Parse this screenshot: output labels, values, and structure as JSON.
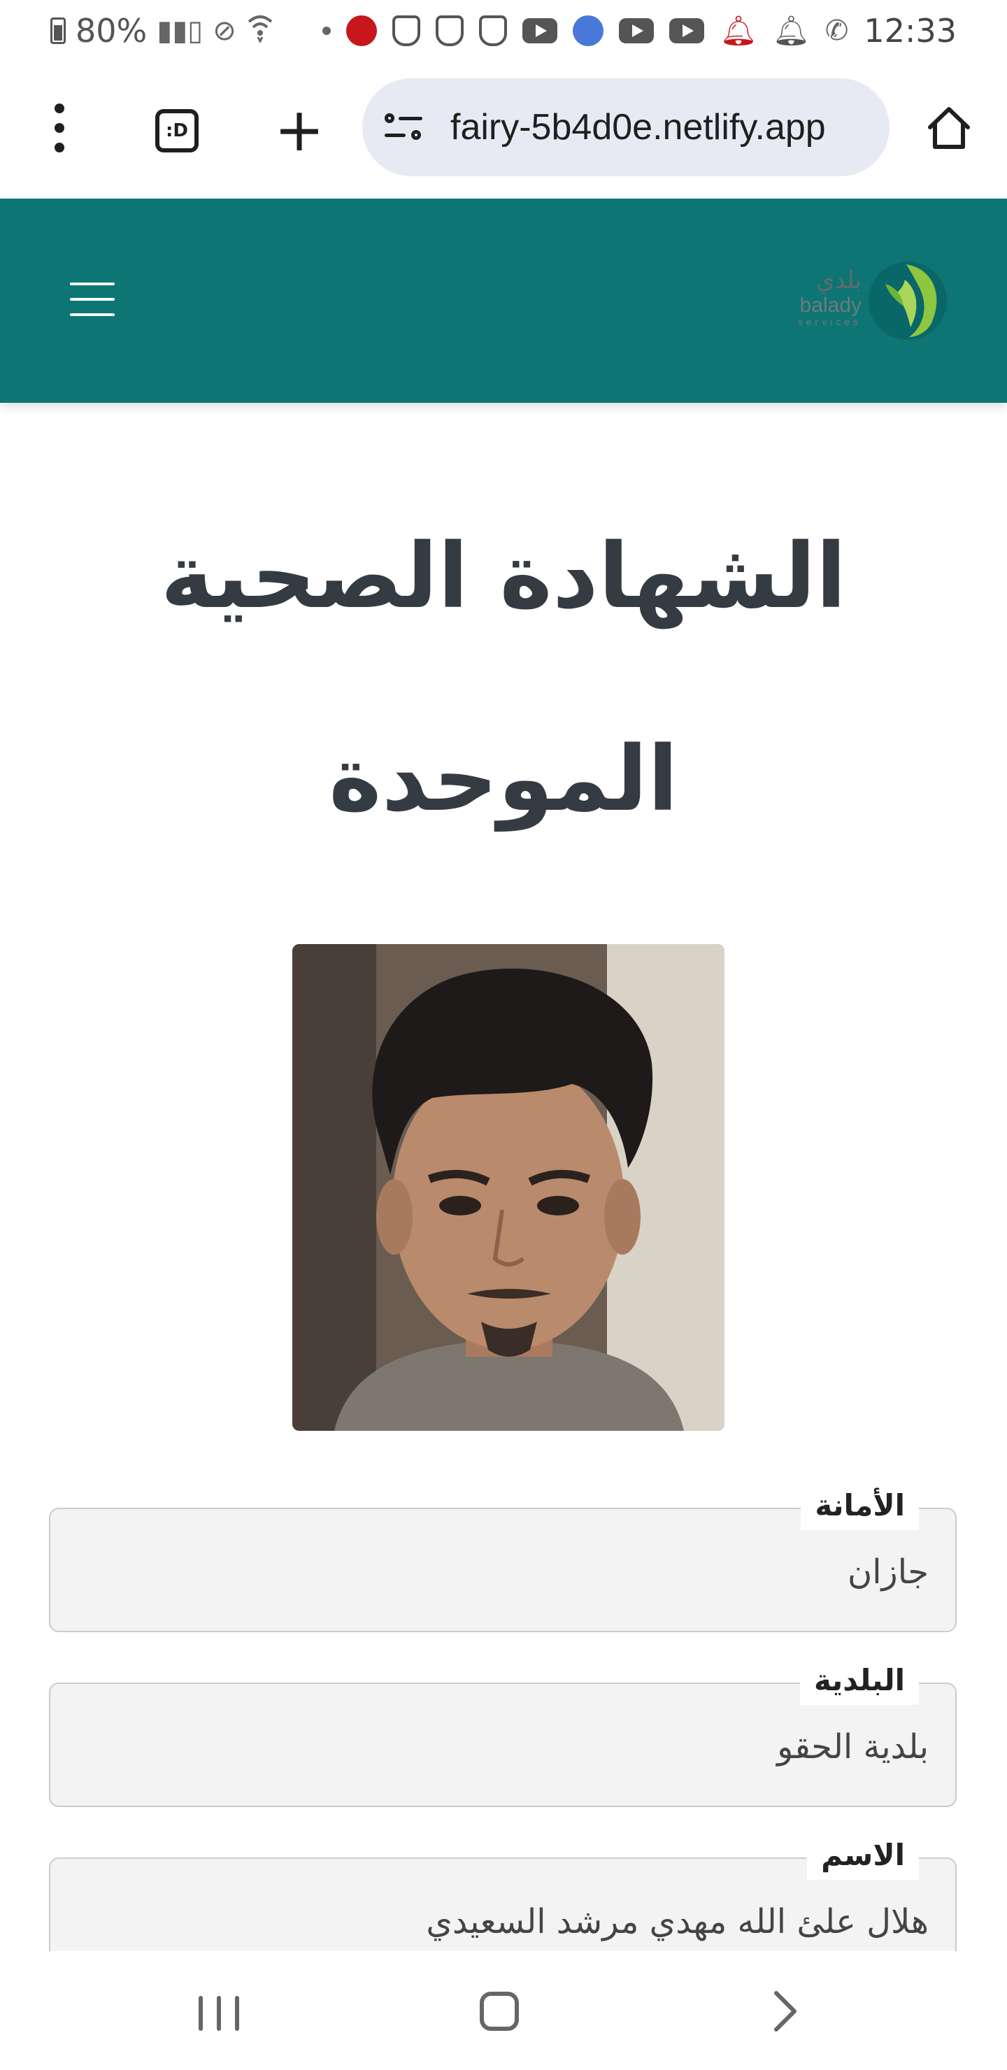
{
  "status_bar": {
    "battery": "80%",
    "time": "12:33",
    "notifications": [
      "app-red-icon",
      "shield-icon",
      "shield-icon",
      "shield-icon",
      "youtube-icon",
      "blue-app-icon",
      "youtube-icon",
      "youtube-icon",
      "bell-red-icon",
      "bell-icon",
      "whatsapp-icon"
    ]
  },
  "browser": {
    "tab_count_label": ":D",
    "url": "fairy-5b4d0e.netlify.app"
  },
  "header": {
    "logo": {
      "arabic": "بلدي",
      "english": "balady",
      "sub": "services"
    },
    "colors": {
      "header_bg": "#0d7574",
      "logo_green": "#8dc63f"
    }
  },
  "page": {
    "title": "الشهادة الصحية الموحدة",
    "fields": [
      {
        "label": "الأمانة",
        "value": "جازان"
      },
      {
        "label": "البلدية",
        "value": "بلدية الحقو"
      },
      {
        "label": "الاسم",
        "value": "هلال علئ الله مهدي مرشد السعيدي"
      }
    ]
  }
}
